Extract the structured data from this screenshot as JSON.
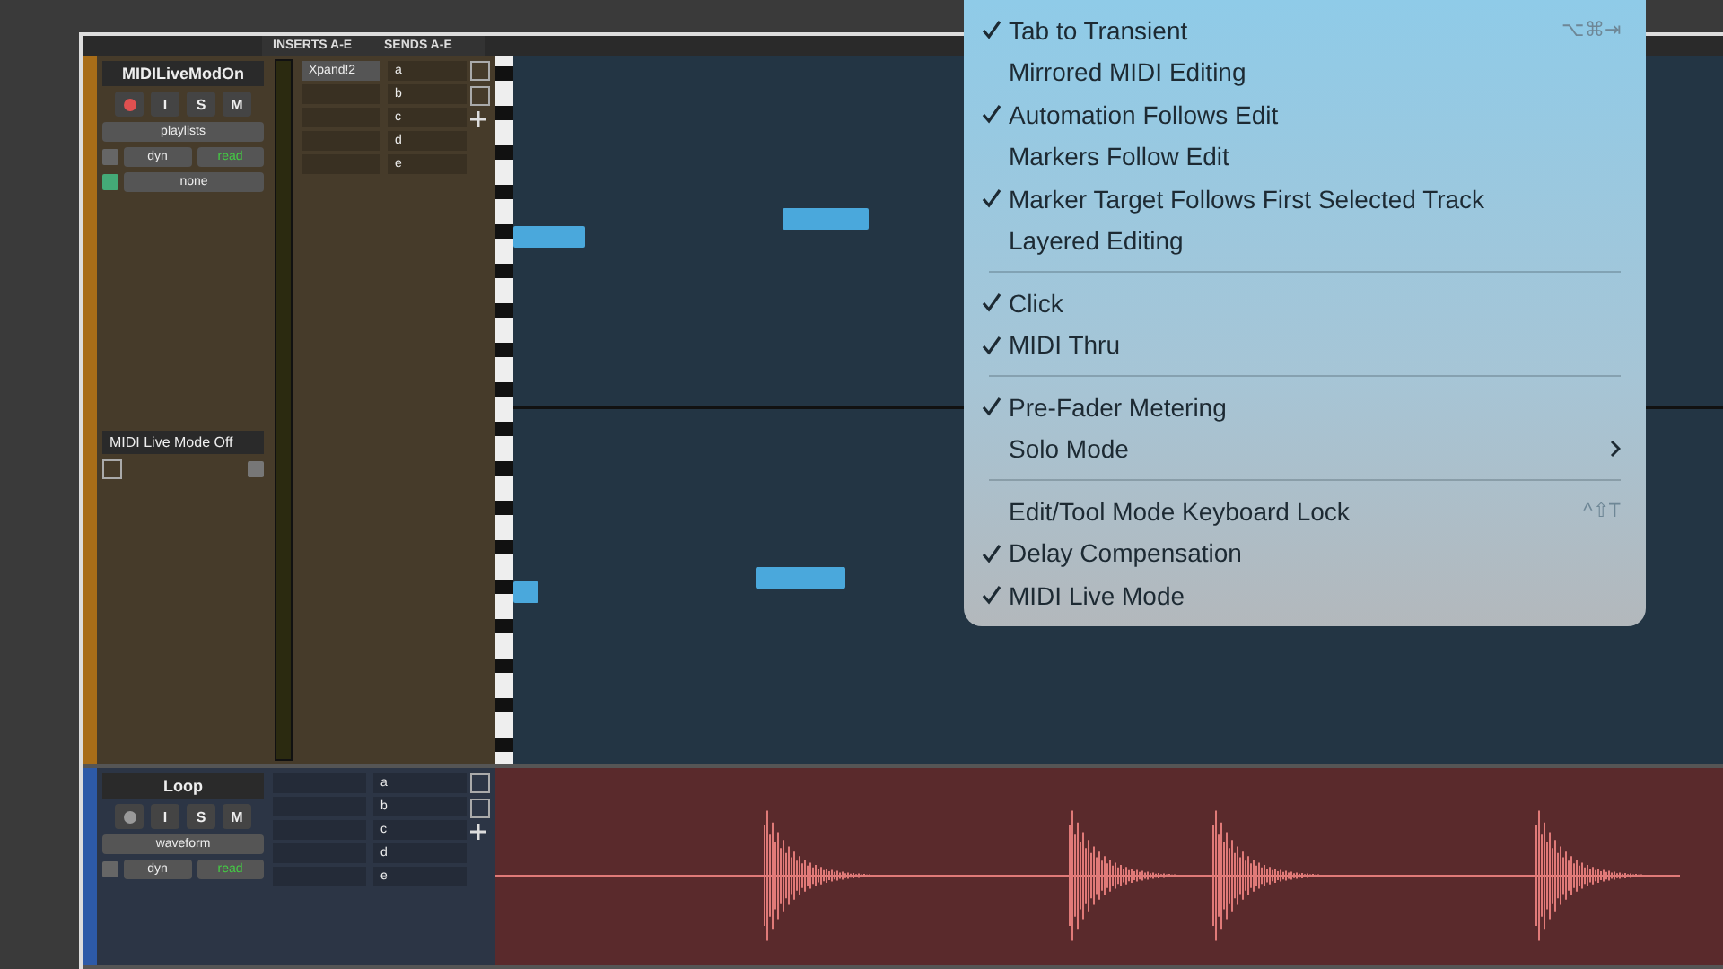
{
  "header": {
    "columns": [
      "INSERTS A-E",
      "SENDS A-E"
    ]
  },
  "tracks": [
    {
      "kind": "midi",
      "name": "MIDILiveModOn",
      "buttons": [
        "I",
        "S",
        "M"
      ],
      "record_armed": true,
      "view": "playlists",
      "dyn": "dyn",
      "automation": "read",
      "output": "none",
      "inserts": [
        "Xpand!2"
      ],
      "sends": [
        "a",
        "b",
        "c",
        "d",
        "e"
      ],
      "lane_label": "MIDI Live Mode Off"
    },
    {
      "kind": "audio",
      "name": "Loop",
      "buttons": [
        "I",
        "S",
        "M"
      ],
      "record_armed": false,
      "view": "waveform",
      "dyn": "dyn",
      "automation": "read",
      "sends": [
        "a",
        "b",
        "c",
        "d",
        "e"
      ]
    }
  ],
  "menu": [
    {
      "kind": "item",
      "label": "Tab to Transient",
      "checked": true,
      "shortcut": "⌥⌘⇥"
    },
    {
      "kind": "item",
      "label": "Mirrored MIDI Editing",
      "checked": false
    },
    {
      "kind": "item",
      "label": "Automation Follows Edit",
      "checked": true
    },
    {
      "kind": "item",
      "label": "Markers Follow Edit",
      "checked": false
    },
    {
      "kind": "item",
      "label": "Marker Target Follows First Selected Track",
      "checked": true
    },
    {
      "kind": "item",
      "label": "Layered Editing",
      "checked": false
    },
    {
      "kind": "separator"
    },
    {
      "kind": "item",
      "label": "Click",
      "checked": true
    },
    {
      "kind": "item",
      "label": "MIDI Thru",
      "checked": true
    },
    {
      "kind": "separator"
    },
    {
      "kind": "item",
      "label": "Pre-Fader Metering",
      "checked": true
    },
    {
      "kind": "item",
      "label": "Solo Mode",
      "checked": false,
      "submenu": true
    },
    {
      "kind": "separator"
    },
    {
      "kind": "item",
      "label": "Edit/Tool Mode Keyboard Lock",
      "checked": false,
      "shortcut": "^⇧T"
    },
    {
      "kind": "item",
      "label": "Delay Compensation",
      "checked": true
    },
    {
      "kind": "item",
      "label": "MIDI Live Mode",
      "checked": true
    }
  ]
}
